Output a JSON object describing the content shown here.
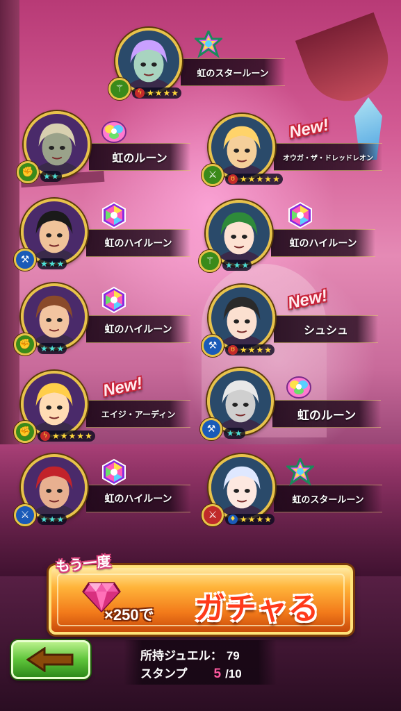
{
  "results": [
    {
      "id": "r1",
      "reward": "虹のスタールーン",
      "element": "wood",
      "element_icon": "staff-icon",
      "stars": 4,
      "skill": "lightning",
      "is_new": false,
      "rune": "star-rune"
    },
    {
      "id": "r2",
      "reward": "虹のルーン",
      "element": "wood",
      "element_icon": "fist-icon",
      "stars": 2,
      "skill": null,
      "is_new": false,
      "rune": "blob-rune"
    },
    {
      "id": "r3",
      "reward": "オウガ・ザ・ドレッドレオン",
      "element": "wood",
      "element_icon": "sword-icon",
      "stars": 5,
      "skill": "fire",
      "is_new": true,
      "rune": null
    },
    {
      "id": "r4",
      "reward": "虹のハイルーン",
      "element": "water",
      "element_icon": "axe-icon",
      "stars": 3,
      "skill": null,
      "is_new": false,
      "rune": "hex-rune"
    },
    {
      "id": "r5",
      "reward": "虹のハイルーン",
      "element": "wood",
      "element_icon": "staff-icon",
      "stars": 3,
      "skill": null,
      "is_new": false,
      "rune": "hex-rune"
    },
    {
      "id": "r6",
      "reward": "虹のハイルーン",
      "element": "wood",
      "element_icon": "fist-icon",
      "stars": 3,
      "skill": null,
      "is_new": false,
      "rune": "hex-rune"
    },
    {
      "id": "r7",
      "reward": "シュシュ",
      "element": "water",
      "element_icon": "axe-icon",
      "stars": 4,
      "skill": "fire",
      "is_new": true,
      "rune": null
    },
    {
      "id": "r8",
      "reward": "エイジ・アーディン",
      "element": "wood",
      "element_icon": "fist-icon",
      "stars": 5,
      "skill": "lightning",
      "is_new": true,
      "rune": null
    },
    {
      "id": "r9",
      "reward": "虹のルーン",
      "element": "water",
      "element_icon": "axe-icon",
      "stars": 2,
      "skill": null,
      "is_new": false,
      "rune": "blob-rune"
    },
    {
      "id": "r10",
      "reward": "虹のハイルーン",
      "element": "water",
      "element_icon": "sword-icon",
      "stars": 3,
      "skill": null,
      "is_new": false,
      "rune": "hex-rune"
    },
    {
      "id": "r11",
      "reward": "虹のスタールーン",
      "element": "fire",
      "element_icon": "sword-icon",
      "stars": 4,
      "skill": "water",
      "is_new": false,
      "rune": "star-rune"
    }
  ],
  "labels": {
    "new": "New!",
    "again": "もう一度",
    "cost": "×250で",
    "gacha": "ガチャる"
  },
  "status": {
    "jewel_label": "所持ジュエル：",
    "jewel_value": "79",
    "stamp_label": "スタンプ",
    "stamp_current": "5",
    "stamp_total": "/10"
  },
  "colors": {
    "wood": "#3a8a1a",
    "water": "#1a5ab8",
    "fire": "#c02a2a",
    "frame_gold": "#e7c34a",
    "accent_new": "#c8243a"
  }
}
